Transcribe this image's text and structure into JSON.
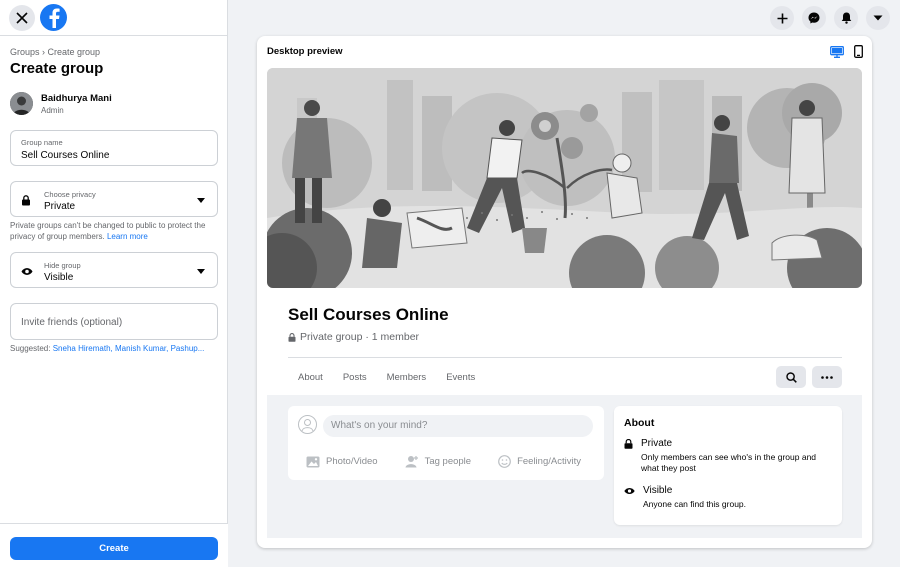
{
  "breadcrumb": "Groups › Create group",
  "page_title": "Create group",
  "admin": {
    "name": "Baidhurya Mani",
    "role": "Admin"
  },
  "group_name_field": {
    "label": "Group name",
    "value": "Sell Courses Online"
  },
  "privacy_field": {
    "label": "Choose privacy",
    "value": "Private"
  },
  "privacy_note": "Private groups can't be changed to public to protect the privacy of group members.",
  "privacy_note_link": "Learn more",
  "hide_field": {
    "label": "Hide group",
    "value": "Visible"
  },
  "invite": {
    "placeholder": "Invite friends (optional)"
  },
  "suggested": {
    "label": "Suggested:",
    "names": [
      "Sneha Hiremath,",
      "Manish Kumar,",
      "Pashup..."
    ]
  },
  "create_button": "Create",
  "preview": {
    "label": "Desktop preview",
    "group_name": "Sell Courses Online",
    "group_meta": "Private group · 1 member",
    "tabs": [
      "About",
      "Posts",
      "Members",
      "Events"
    ],
    "composer_placeholder": "What's on your mind?",
    "composer_actions": [
      "Photo/Video",
      "Tag people",
      "Feeling/Activity"
    ],
    "about": {
      "title": "About",
      "items": [
        {
          "title": "Private",
          "desc": "Only members can see who's in the group and what they post"
        },
        {
          "title": "Visible",
          "desc": "Anyone can find this group."
        }
      ]
    }
  },
  "colors": {
    "accent": "#1877f2",
    "background": "#f0f2f5",
    "secondary_text": "#65676b"
  }
}
